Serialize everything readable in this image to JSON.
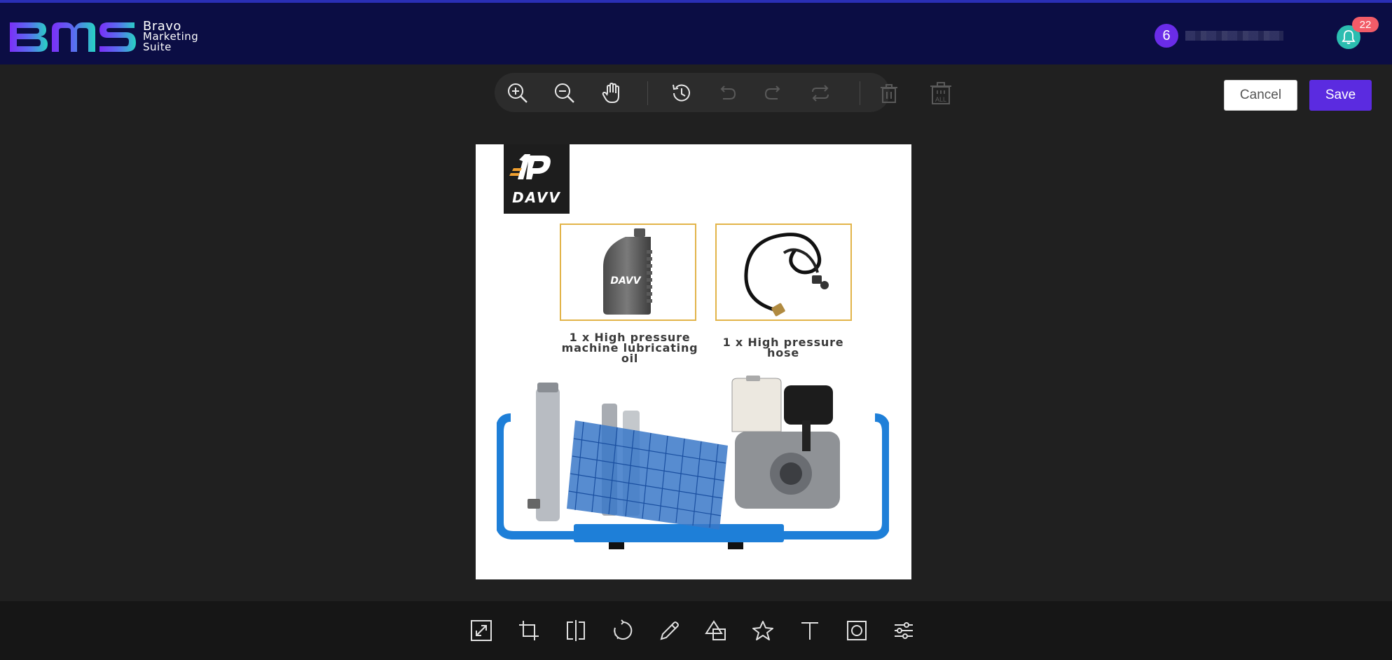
{
  "brand": {
    "logo_letters": "BMS",
    "name_line1": "Bravo",
    "name_line2": "Marketing",
    "name_line3": "Suite"
  },
  "user": {
    "avatar_letter": "6"
  },
  "notifications": {
    "count": "22"
  },
  "top_toolbar": {
    "items": [
      {
        "name": "zoom-in-icon",
        "enabled": true
      },
      {
        "name": "zoom-out-icon",
        "enabled": true
      },
      {
        "name": "hand-pan-icon",
        "enabled": true
      },
      {
        "name": "history-icon",
        "enabled": true
      },
      {
        "name": "undo-icon",
        "enabled": false
      },
      {
        "name": "redo-icon",
        "enabled": false
      },
      {
        "name": "reset-icon",
        "enabled": false
      },
      {
        "name": "delete-icon",
        "enabled": false
      },
      {
        "name": "delete-all-icon",
        "enabled": false
      }
    ],
    "delete_all_label": "ALL"
  },
  "actions": {
    "cancel_label": "Cancel",
    "save_label": "Save"
  },
  "image": {
    "brand_name": "DAVV",
    "bottle_label": "DAVV",
    "caption_oil_line1": "1 x High pressure",
    "caption_oil_line2": "machine lubricating oil",
    "caption_hose": "1 x High pressure hose"
  },
  "bottom_toolbar": {
    "items": [
      "resize-icon",
      "crop-icon",
      "flip-icon",
      "rotate-icon",
      "draw-icon",
      "shape-icon",
      "icon-star-icon",
      "text-icon",
      "mask-icon",
      "filter-icon"
    ]
  },
  "colors": {
    "header_bg": "#0b0d44",
    "accent": "#5b2be0",
    "notification_badge": "#f25c68",
    "bell_bg": "#2bbdb0",
    "frame_border": "#e2b449"
  }
}
